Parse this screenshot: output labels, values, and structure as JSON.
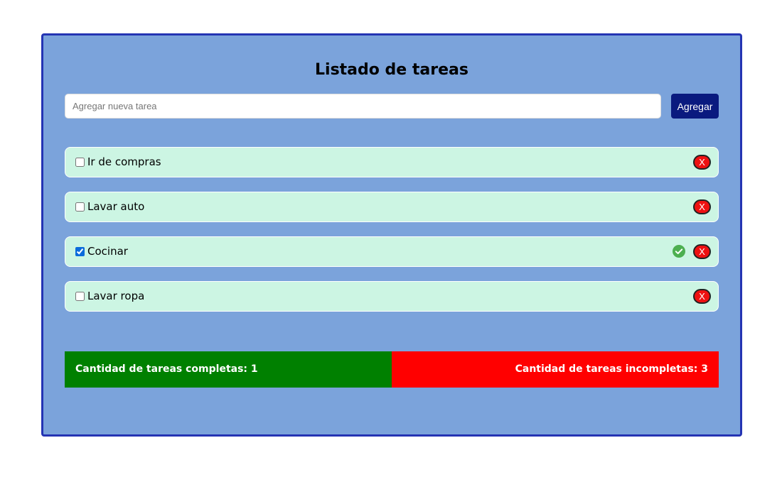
{
  "header": {
    "title": "Listado de tareas"
  },
  "new_task": {
    "placeholder": "Agregar nueva tarea",
    "value": "",
    "add_label": "Agregar"
  },
  "tasks": [
    {
      "label": "Ir de compras",
      "completed": false,
      "delete_label": "X"
    },
    {
      "label": "Lavar auto",
      "completed": false,
      "delete_label": "X"
    },
    {
      "label": "Cocinar",
      "completed": true,
      "delete_label": "X",
      "status_icon": "check-circle-icon"
    },
    {
      "label": "Lavar ropa",
      "completed": false,
      "delete_label": "X"
    }
  ],
  "summary": {
    "complete_text": "Cantidad de tareas completas: 1",
    "incomplete_text": "Cantidad de tareas incompletas: 3"
  },
  "colors": {
    "card_background": "#7ba3db",
    "card_border": "#2434b3",
    "task_background": "#ccf5e3",
    "add_button": "#0a1a7f",
    "delete_button": "#ee1111",
    "complete_bar": "#008000",
    "incomplete_bar": "#ff0000",
    "check_icon": "#4caf50"
  }
}
